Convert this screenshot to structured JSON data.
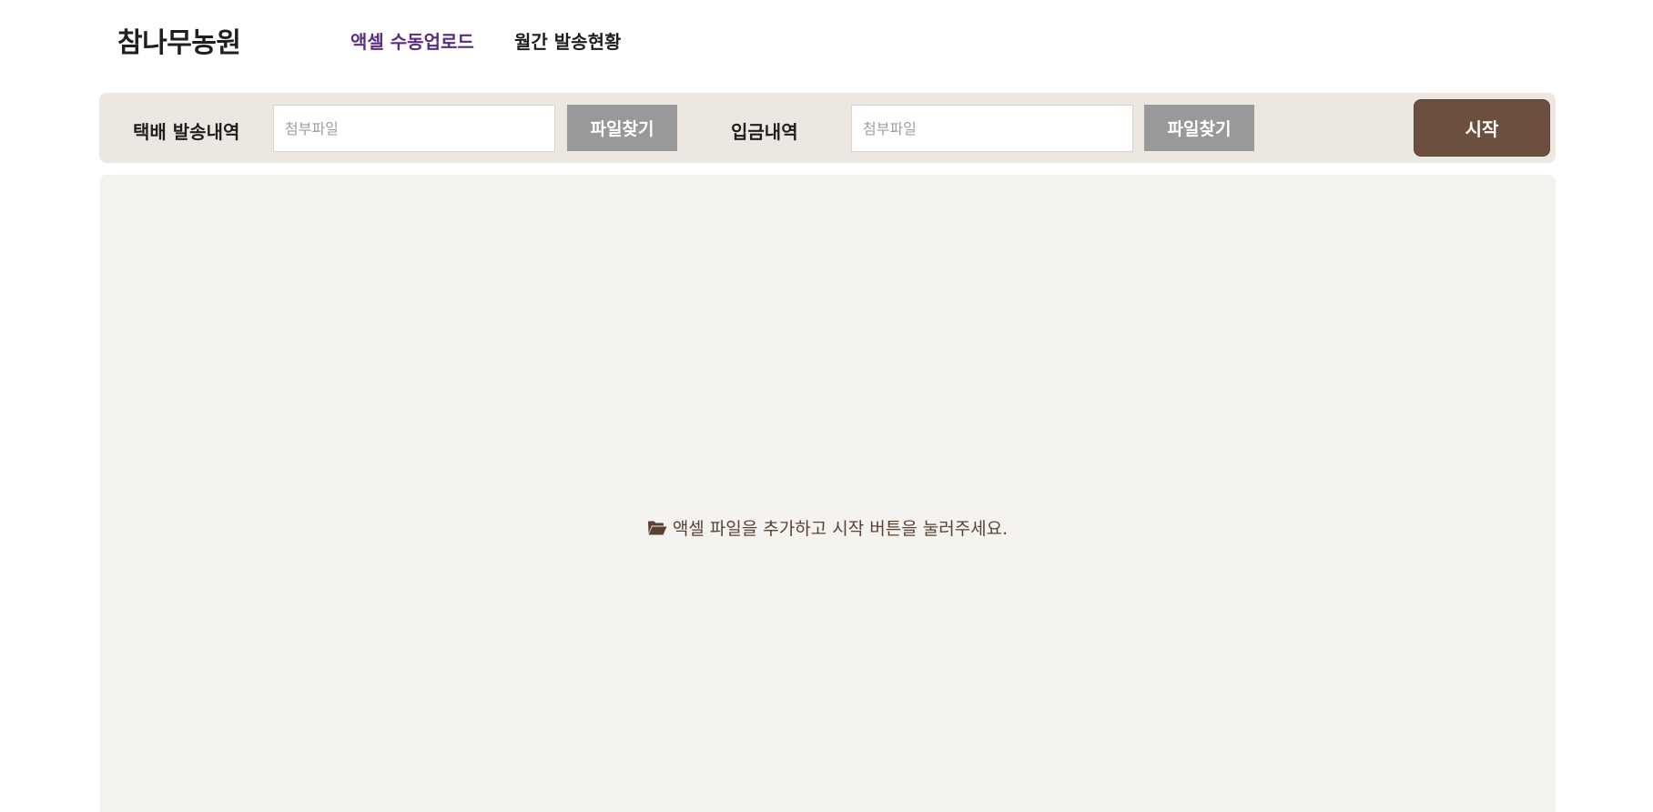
{
  "header": {
    "brand": "참나무농원",
    "nav": [
      {
        "label": "액셀 수동업로드",
        "active": true
      },
      {
        "label": "월간 발송현황",
        "active": false
      }
    ]
  },
  "toolbar": {
    "delivery": {
      "label": "택배 발송내역",
      "placeholder": "첨부파일",
      "button": "파일찾기"
    },
    "deposit": {
      "label": "입금내역",
      "placeholder": "첨부파일",
      "button": "파일찾기"
    },
    "start_label": "시작"
  },
  "main": {
    "empty_icon": "folder-open-icon",
    "empty_message": "액셀 파일을 추가하고 시작 버튼을 눌러주세요."
  },
  "colors": {
    "accent_nav": "#5a2d82",
    "start_button": "#6b4f3f",
    "find_button": "#999999",
    "toolbar_bg": "#ece8e1",
    "panel_bg": "#f5f3ef"
  }
}
